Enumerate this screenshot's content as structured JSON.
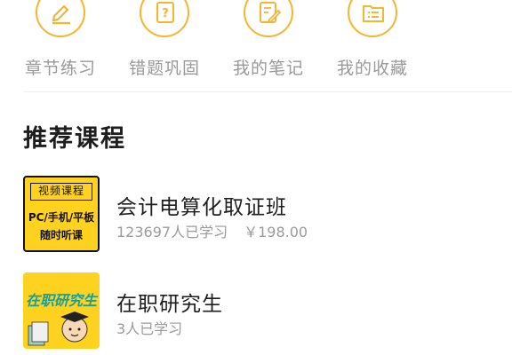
{
  "quick_actions": [
    {
      "label": "章节练习",
      "icon": "pencil-paper-icon"
    },
    {
      "label": "错题巩固",
      "icon": "question-book-icon"
    },
    {
      "label": "我的笔记",
      "icon": "note-edit-icon"
    },
    {
      "label": "我的收藏",
      "icon": "folder-list-icon"
    }
  ],
  "section_title": "推荐课程",
  "courses": [
    {
      "name": "会计电算化取证班",
      "learners": "123697人已学习",
      "price": "￥198.00",
      "thumb_lines": [
        "视频课程",
        "PC/手机/平板",
        "随时听课"
      ]
    },
    {
      "name": "在职研究生",
      "learners": "3人已学习",
      "price": "",
      "thumb_lines": [
        "在职研究生"
      ]
    }
  ],
  "colors": {
    "accent": "#f5b52c",
    "thumb_yellow": "#ffd21f",
    "muted_text": "#999999"
  }
}
